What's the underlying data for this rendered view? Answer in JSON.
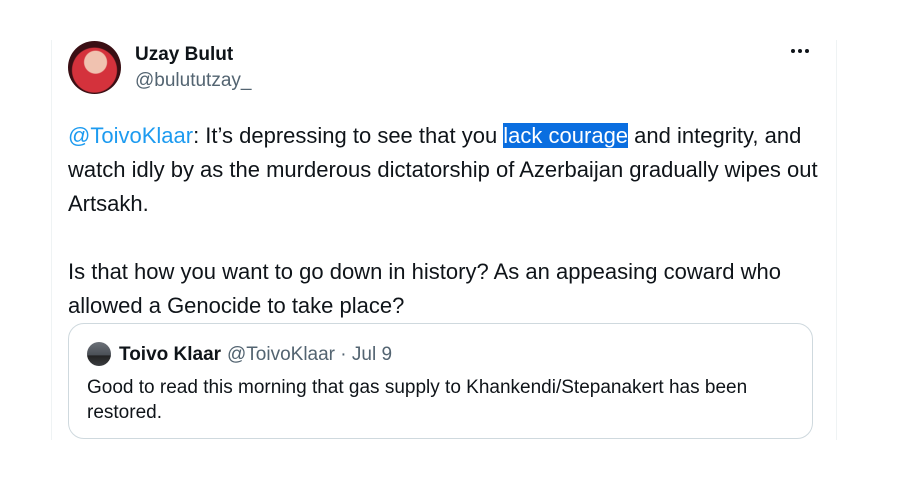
{
  "author": {
    "display_name": "Uzay Bulut",
    "handle": "@bulututzay_"
  },
  "more_icon": "more-horizontal-icon",
  "tweet": {
    "mention": "@ToivoKlaar",
    "text_part1": ": It’s depressing to see that you ",
    "highlighted": "lack courage",
    "text_part2": " and integrity, and watch idly by as the murderous dictatorship of Azerbaijan gradually wipes out Artsakh.",
    "paragraph2": "Is that how you want to go down in history? As an appeasing coward who allowed a Genocide to take place?"
  },
  "quoted_tweet": {
    "display_name": "Toivo Klaar",
    "handle_date": "@ToivoKlaar · Jul 9",
    "text": "Good to read this morning that gas supply to Khankendi/Stepanakert has been restored."
  },
  "colors": {
    "link": "#1d9bf0",
    "selection": "#0a6ee0",
    "secondary_text": "#536471",
    "border": "#cfd9de"
  }
}
